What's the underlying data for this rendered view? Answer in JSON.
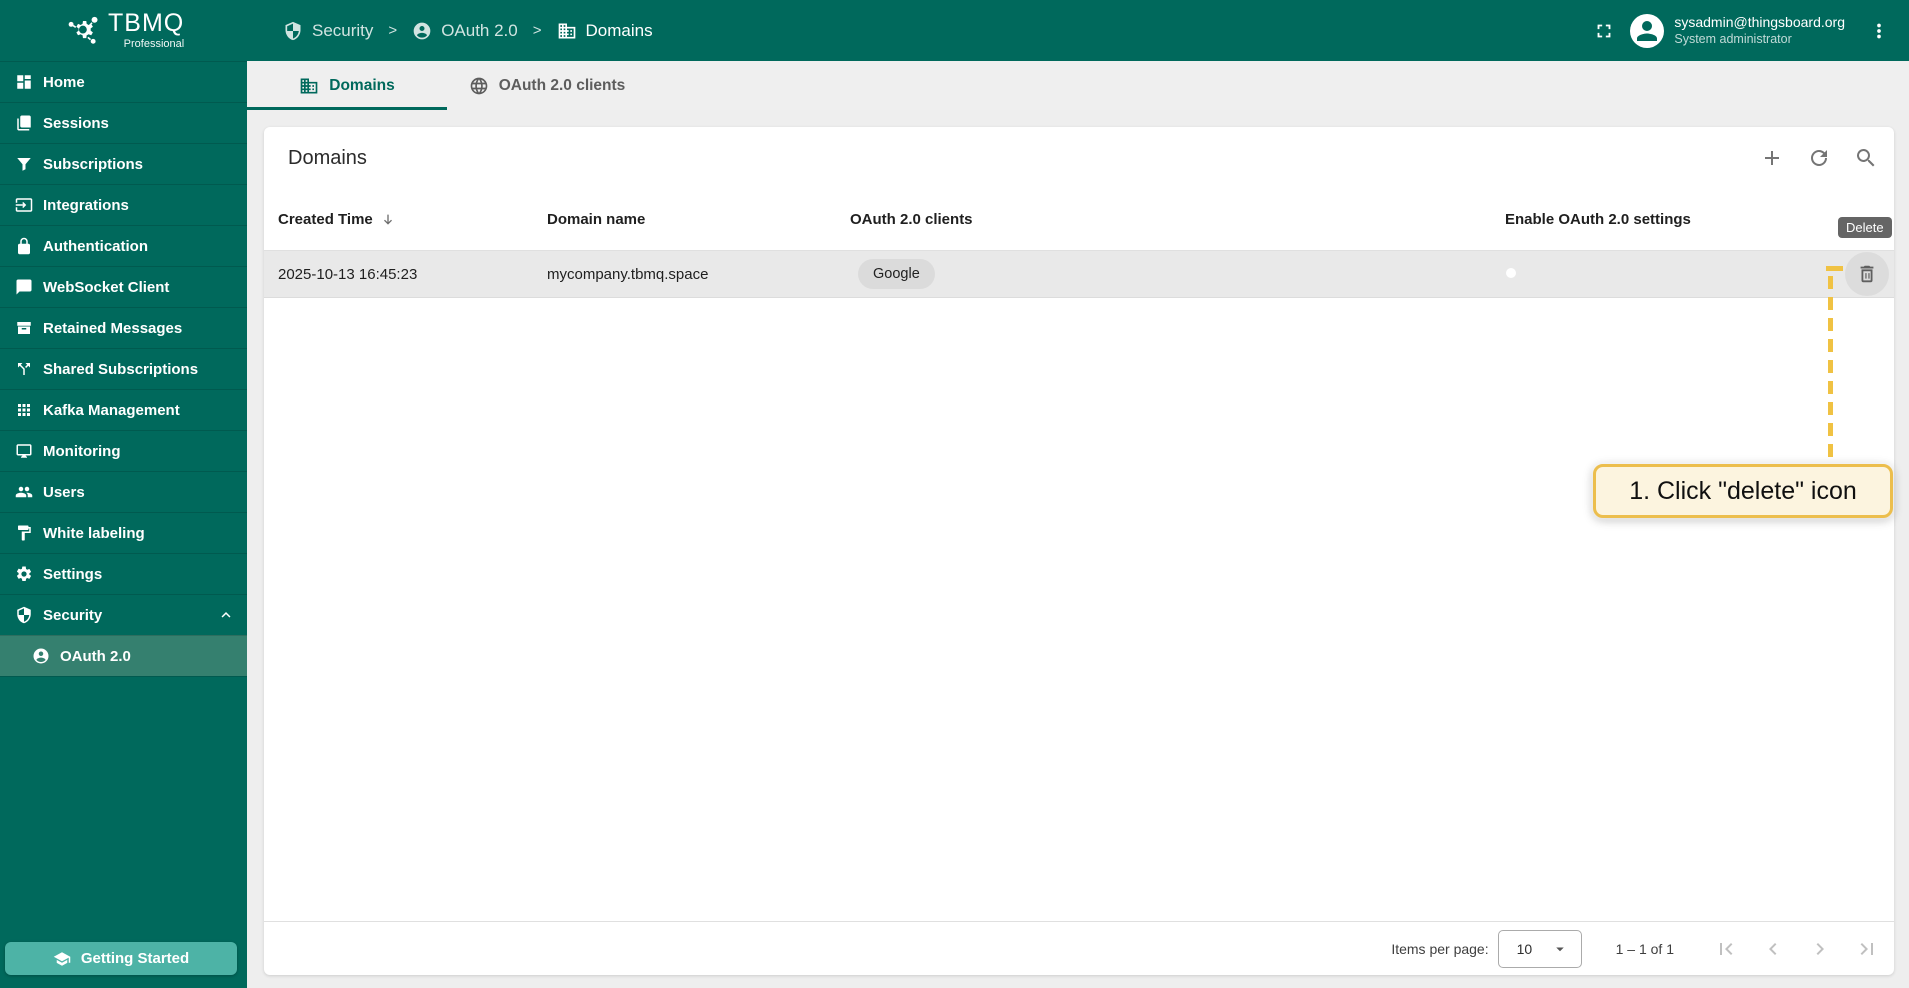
{
  "colors": {
    "primary": "#00695c",
    "sidebar_selected": "#35806f",
    "button_teal": "#4db3a6",
    "page_bg": "#eeeeee",
    "row_bg": "#e9e9e9",
    "accent_yellow": "#f0c243",
    "callout_bg": "#fcf4df",
    "callout_border": "#ecbe4d",
    "tooltip_bg": "#656565"
  },
  "brand": {
    "name": "TBMQ",
    "subtitle": "Professional"
  },
  "header": {
    "separator": ">",
    "breadcrumb": [
      {
        "label": "Security",
        "icon": "shield"
      },
      {
        "label": "OAuth 2.0",
        "icon": "user-circle"
      },
      {
        "label": "Domains",
        "icon": "domain"
      }
    ],
    "user": {
      "email": "sysadmin@thingsboard.org",
      "role": "System administrator"
    }
  },
  "sidebar": {
    "items": [
      {
        "label": "Home",
        "icon": "dashboard"
      },
      {
        "label": "Sessions",
        "icon": "sessions"
      },
      {
        "label": "Subscriptions",
        "icon": "filter"
      },
      {
        "label": "Integrations",
        "icon": "integrations"
      },
      {
        "label": "Authentication",
        "icon": "lock"
      },
      {
        "label": "WebSocket Client",
        "icon": "chat"
      },
      {
        "label": "Retained Messages",
        "icon": "archive"
      },
      {
        "label": "Shared Subscriptions",
        "icon": "split"
      },
      {
        "label": "Kafka Management",
        "icon": "apps"
      },
      {
        "label": "Monitoring",
        "icon": "monitor"
      },
      {
        "label": "Users",
        "icon": "users"
      },
      {
        "label": "White labeling",
        "icon": "paint"
      },
      {
        "label": "Settings",
        "icon": "gear"
      },
      {
        "label": "Security",
        "icon": "shield",
        "expanded": true
      },
      {
        "label": "OAuth 2.0",
        "icon": "user-circle",
        "sub": true,
        "selected": true
      }
    ],
    "getting_started": "Getting Started"
  },
  "tabs": [
    {
      "label": "Domains",
      "icon": "domain",
      "active": true
    },
    {
      "label": "OAuth 2.0 clients",
      "icon": "globe",
      "active": false
    }
  ],
  "card": {
    "title": "Domains"
  },
  "table": {
    "headers": [
      "Created Time",
      "Domain name",
      "OAuth 2.0 clients",
      "Enable OAuth 2.0 settings"
    ],
    "sort_column": "Created Time",
    "rows": [
      {
        "created_time": "2025-10-13 16:45:23",
        "domain_name": "mycompany.tbmq.space",
        "clients": [
          "Google"
        ],
        "enable_oauth": true
      }
    ]
  },
  "tooltip": {
    "label": "Delete"
  },
  "annotation": {
    "label": "1. Click \"delete\" icon"
  },
  "pagination": {
    "items_per_page_label": "Items per page:",
    "page_size": "10",
    "range_label": "1 – 1 of 1"
  }
}
